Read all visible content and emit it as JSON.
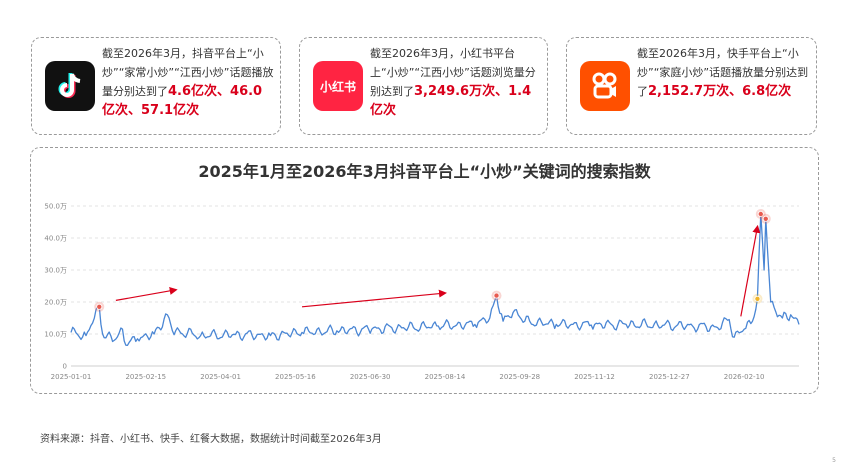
{
  "cards": [
    {
      "platform_icon": "douyin-icon",
      "text_parts": [
        "截至2026年3月，抖音平台上“小炒”“家常小炒”“江西小炒”话题播放量分别达到了"
      ],
      "highlight": "4.6亿次、46.0亿次、57.1亿次"
    },
    {
      "platform_icon": "xiaohongshu-icon",
      "icon_label": "小红书",
      "text_parts": [
        "截至2026年3月，小红书平台上“小炒”“江西小炒”话题浏览量分别达到了"
      ],
      "highlight": "3,249.6万次、1.4亿次"
    },
    {
      "platform_icon": "kuaishou-icon",
      "text_parts": [
        "截至2026年3月，快手平台上“小炒”“家庭小炒”话题播放量分别达到了"
      ],
      "highlight": "2,152.7万次、6.8亿次"
    }
  ],
  "chart_data": {
    "type": "line",
    "title": "2025年1月至2026年3月抖音平台上“小炒”关键词的搜索指数",
    "y_ticks": [
      "0",
      "10.0万",
      "20.0万",
      "30.0万",
      "40.0万",
      "50.0万"
    ],
    "ylim": [
      0,
      500000
    ],
    "x_ticks": [
      "2025-01-01",
      "2025-02-15",
      "2025-04-01",
      "2025-05-16",
      "2025-06-30",
      "2025-08-14",
      "2025-09-28",
      "2025-11-12",
      "2025-12-27",
      "2026-02-10"
    ],
    "x_start": "2025-01-01",
    "x_end": "2026-03-15",
    "grid": true,
    "series_color": "#4a86d4",
    "keypoints": [
      [
        "2025-01-01",
        105000
      ],
      [
        "2025-01-10",
        95000
      ],
      [
        "2025-01-18",
        185000
      ],
      [
        "2025-01-20",
        100000
      ],
      [
        "2025-01-27",
        80000
      ],
      [
        "2025-02-01",
        115000
      ],
      [
        "2025-02-03",
        65000
      ],
      [
        "2025-02-10",
        85000
      ],
      [
        "2025-02-20",
        100000
      ],
      [
        "2025-02-28",
        160000
      ],
      [
        "2025-03-03",
        110000
      ],
      [
        "2025-03-20",
        95000
      ],
      [
        "2025-04-10",
        98000
      ],
      [
        "2025-05-01",
        95000
      ],
      [
        "2025-05-20",
        105000
      ],
      [
        "2025-06-10",
        110000
      ],
      [
        "2025-07-01",
        115000
      ],
      [
        "2025-07-20",
        120000
      ],
      [
        "2025-08-10",
        125000
      ],
      [
        "2025-09-01",
        130000
      ],
      [
        "2025-09-10",
        150000
      ],
      [
        "2025-09-14",
        220000
      ],
      [
        "2025-09-18",
        140000
      ],
      [
        "2025-09-25",
        175000
      ],
      [
        "2025-10-01",
        140000
      ],
      [
        "2025-10-20",
        130000
      ],
      [
        "2025-11-10",
        128000
      ],
      [
        "2025-12-01",
        130000
      ],
      [
        "2025-12-20",
        128000
      ],
      [
        "2026-01-10",
        125000
      ],
      [
        "2026-01-25",
        120000
      ],
      [
        "2026-02-01",
        145000
      ],
      [
        "2026-02-04",
        90000
      ],
      [
        "2026-02-10",
        115000
      ],
      [
        "2026-02-15",
        140000
      ],
      [
        "2026-02-18",
        210000
      ],
      [
        "2026-02-20",
        475000
      ],
      [
        "2026-02-22",
        300000
      ],
      [
        "2026-02-23",
        460000
      ],
      [
        "2026-02-26",
        200000
      ],
      [
        "2026-03-01",
        170000
      ],
      [
        "2026-03-05",
        150000
      ],
      [
        "2026-03-10",
        160000
      ],
      [
        "2026-03-15",
        130000
      ]
    ],
    "markers": [
      {
        "date": "2025-01-18",
        "value": 185000,
        "color": "#e85a4f"
      },
      {
        "date": "2025-09-14",
        "value": 220000,
        "color": "#e85a4f"
      },
      {
        "date": "2026-02-18",
        "value": 210000,
        "color": "#f0b429"
      },
      {
        "date": "2026-02-20",
        "value": 475000,
        "color": "#e85a4f"
      },
      {
        "date": "2026-02-23",
        "value": 460000,
        "color": "#e85a4f"
      }
    ],
    "trend_arrows": [
      {
        "from": [
          "2025-01-28",
          205000
        ],
        "to": [
          "2025-03-05",
          238000
        ]
      },
      {
        "from": [
          "2025-05-20",
          185000
        ],
        "to": [
          "2025-08-14",
          228000
        ]
      },
      {
        "from": [
          "2026-02-08",
          155000
        ],
        "to": [
          "2026-02-18",
          435000
        ]
      }
    ]
  },
  "source": "资料来源：抖音、小红书、快手、红餐大数据，数据统计时间截至2026年3月",
  "page_number": "5"
}
